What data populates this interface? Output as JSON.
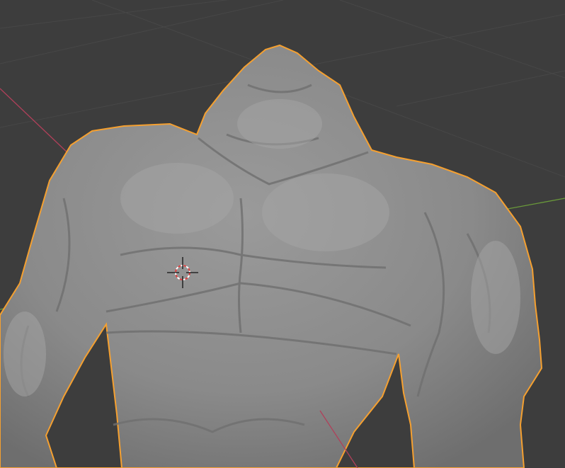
{
  "viewport": {
    "background_color": "#3d3d3d",
    "grid_color": "#474747",
    "x_axis_color": "#b0405a",
    "y_axis_color": "#6a9a3a",
    "selection_outline_color": "#f5a030",
    "mesh_color": "#8c8c8c"
  },
  "icons": {
    "cursor": "3d-cursor-icon"
  }
}
